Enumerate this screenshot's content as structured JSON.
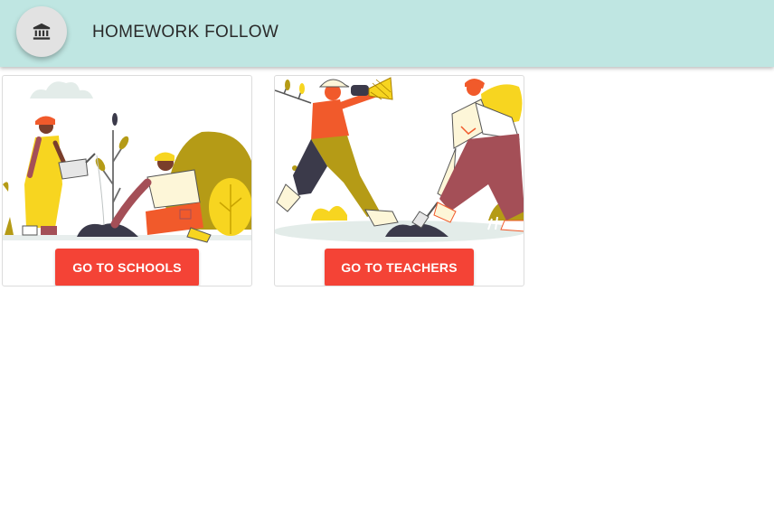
{
  "header": {
    "title": "HOMEWORK FOLLOW",
    "home_icon": "bank-building-icon",
    "background": "#bfe6e2"
  },
  "cards": [
    {
      "button_label": "GO TO SCHOOLS",
      "illustration": "people-planting-illustration"
    },
    {
      "button_label": "GO TO TEACHERS",
      "illustration": "explorers-illustration"
    }
  ],
  "colors": {
    "accent": "#f44336",
    "yellow": "#f7d520",
    "olive": "#b59b16",
    "maroon": "#a44f57",
    "orange": "#f15a2b"
  }
}
